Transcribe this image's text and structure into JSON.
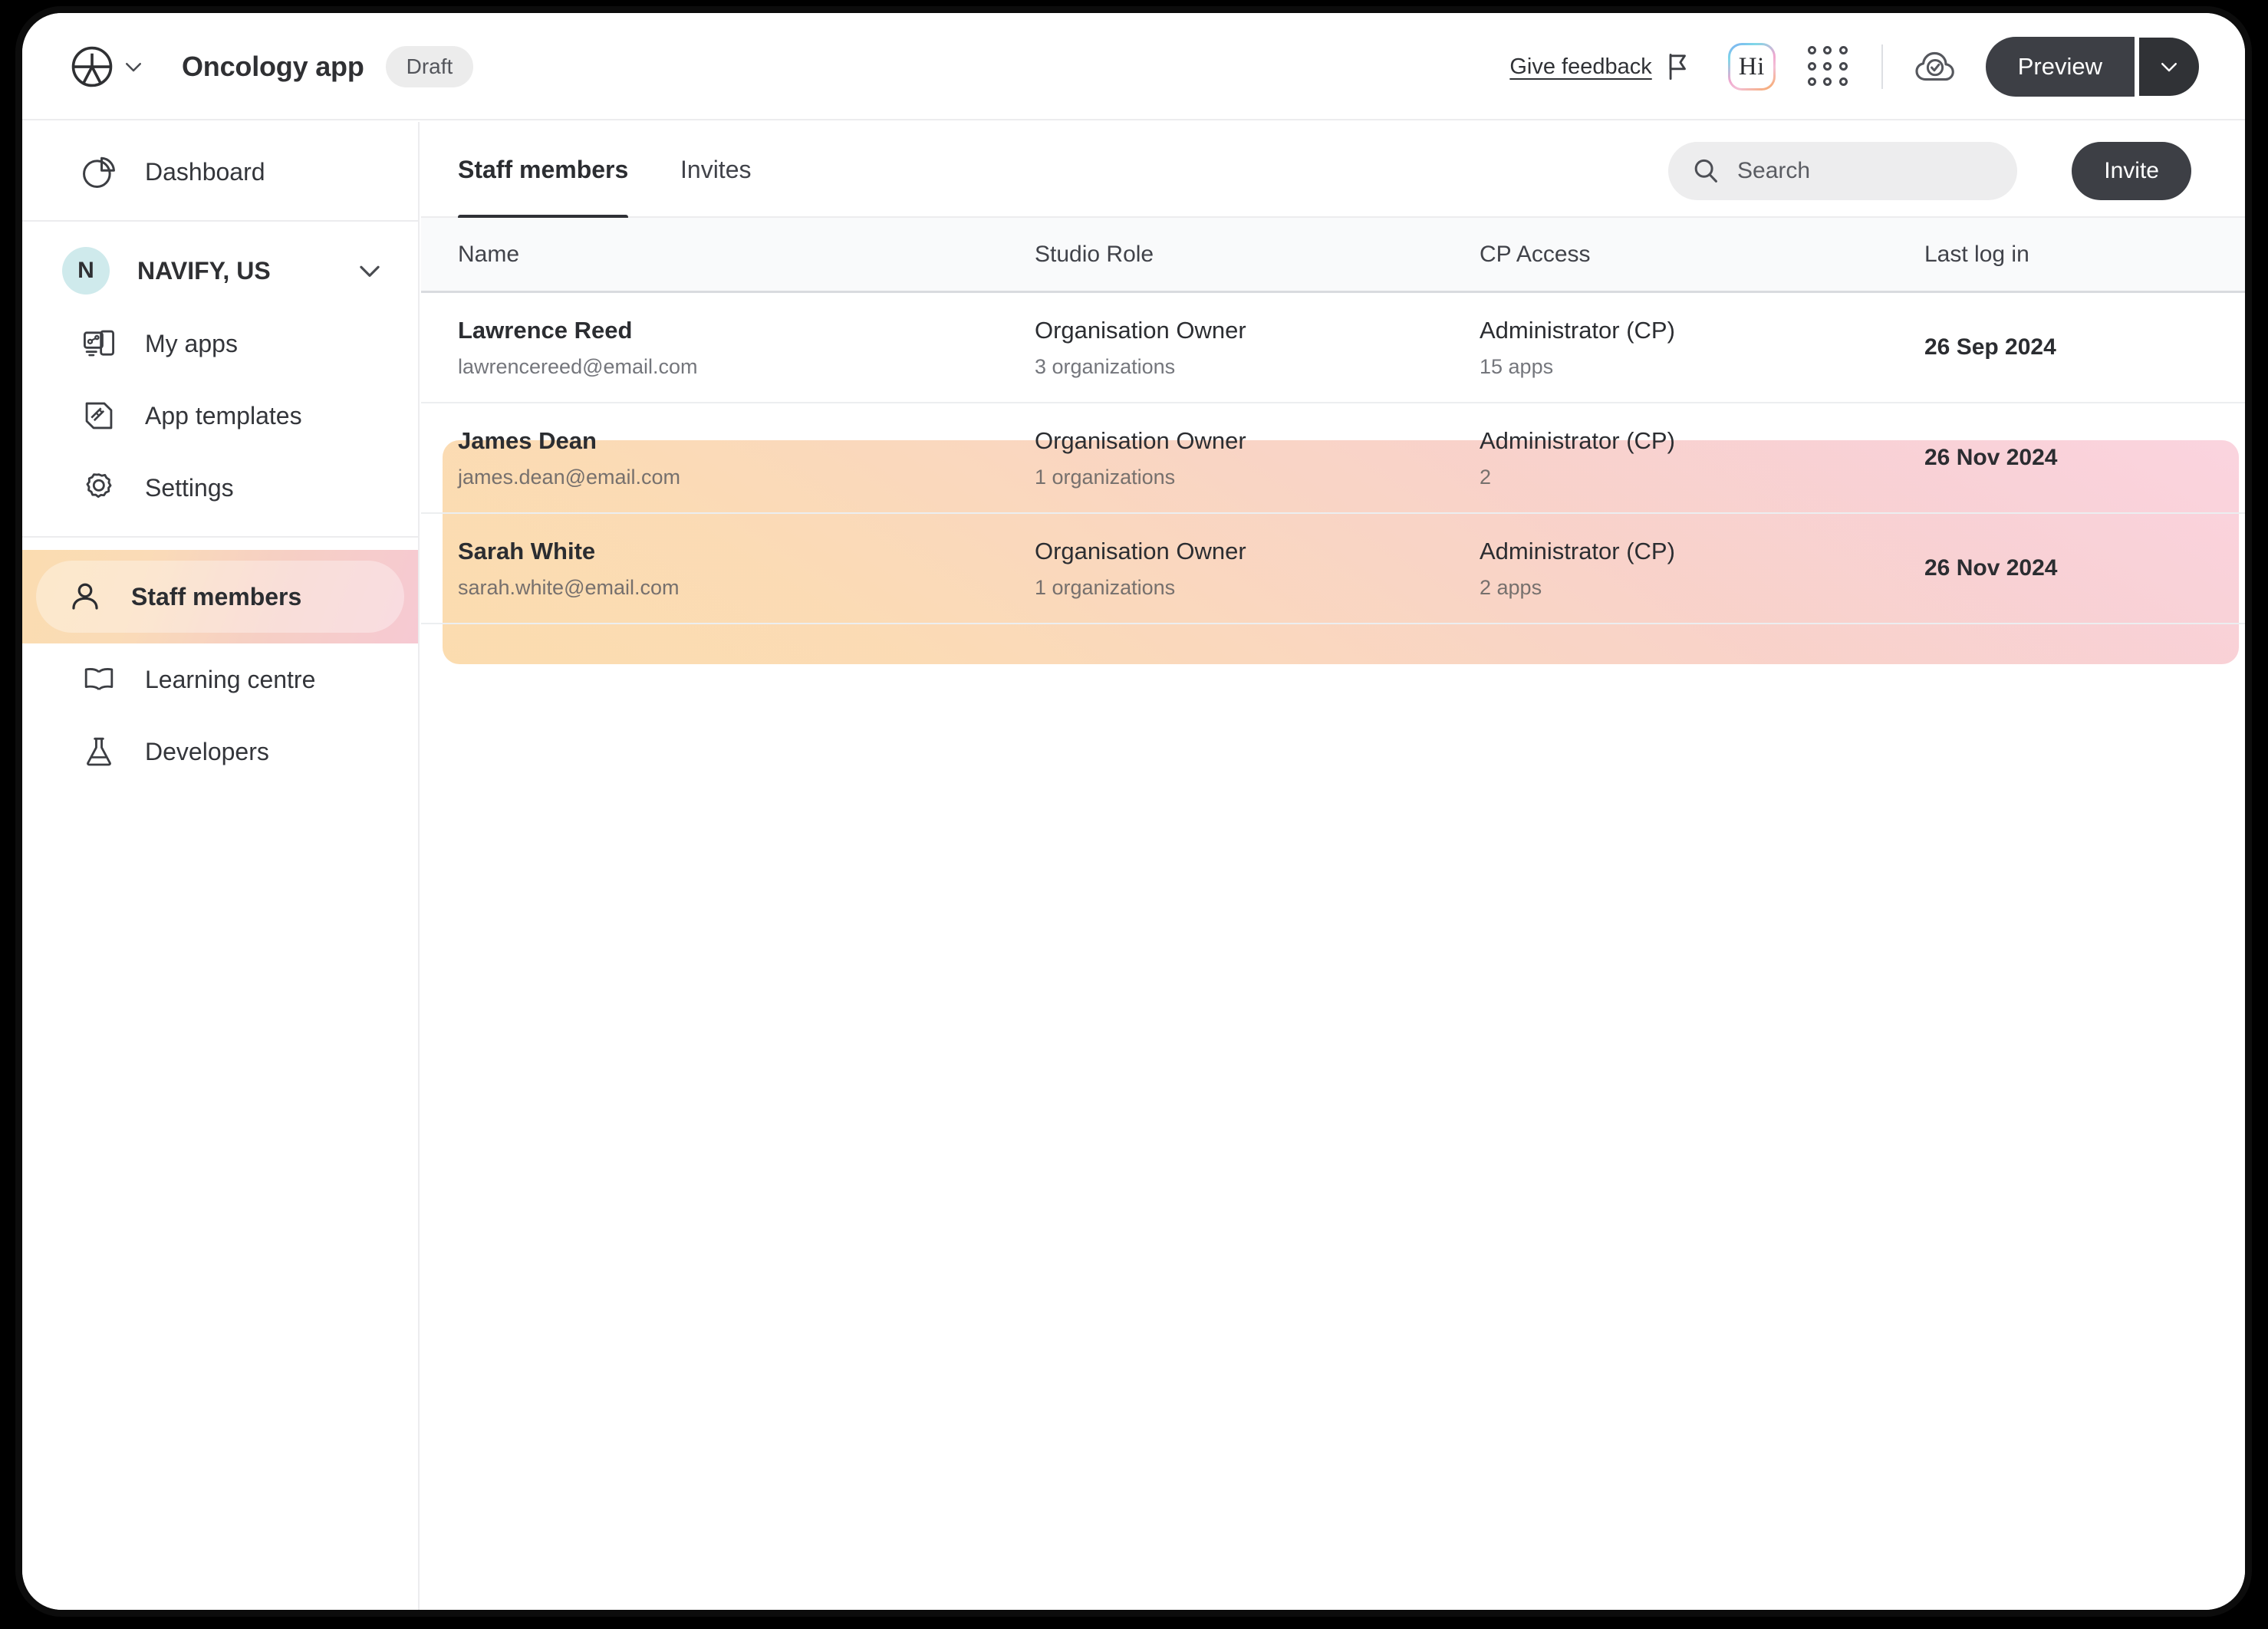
{
  "topbar": {
    "logo_icon": "roche-logo-icon",
    "logo_caret_icon": "chevron-down-icon",
    "app_title": "Oncology app",
    "status_pill": "Draft",
    "feedback_label": "Give feedback",
    "flag_icon": "flag-icon",
    "assistant_badge": "Hi",
    "grid_icon": "app-grid-icon",
    "cloud_icon": "cloud-check-icon",
    "preview_label": "Preview",
    "preview_caret_icon": "chevron-down-icon"
  },
  "sidebar": {
    "dashboard": {
      "label": "Dashboard",
      "icon": "pie-chart-icon"
    },
    "org": {
      "initial": "N",
      "name": "NAVIFY, US",
      "caret_icon": "chevron-down-icon"
    },
    "items": [
      {
        "label": "My apps",
        "icon": "apps-devices-icon",
        "selected": false
      },
      {
        "label": "App templates",
        "icon": "ruler-template-icon",
        "selected": false
      },
      {
        "label": "Settings",
        "icon": "gear-icon",
        "selected": false
      }
    ],
    "items2": [
      {
        "label": "Staff members",
        "icon": "user-icon",
        "selected": true
      },
      {
        "label": "Learning centre",
        "icon": "book-icon",
        "selected": false
      },
      {
        "label": "Developers",
        "icon": "flask-icon",
        "selected": false
      }
    ]
  },
  "main": {
    "tabs": [
      {
        "label": "Staff members",
        "active": true
      },
      {
        "label": "Invites",
        "active": false
      }
    ],
    "search": {
      "placeholder": "Search",
      "value": "",
      "icon": "search-icon"
    },
    "invite_button": "Invite",
    "table": {
      "columns": [
        "Name",
        "Studio Role",
        "CP Access",
        "Last log in"
      ],
      "row_menu_icon": "more-horizontal-icon",
      "rows": [
        {
          "name": "Lawrence Reed",
          "email": "lawrencereed@email.com",
          "role": "Organisation Owner",
          "role_sub": "3 organizations",
          "cp_access": "Administrator (CP)",
          "cp_sub": "15 apps",
          "last_login": "26 Sep 2024",
          "selected": false
        },
        {
          "name": "James Dean",
          "email": "james.dean@email.com",
          "role": "Organisation Owner",
          "role_sub": "1 organizations",
          "cp_access": "Administrator (CP)",
          "cp_sub": "2",
          "last_login": "26 Nov 2024",
          "selected": true
        },
        {
          "name": "Sarah White",
          "email": "sarah.white@email.com",
          "role": "Organisation Owner",
          "role_sub": "1 organizations",
          "cp_access": "Administrator (CP)",
          "cp_sub": "2 apps",
          "last_login": "26 Nov 2024",
          "selected": true
        }
      ]
    }
  },
  "colors": {
    "dark_button": "#3d3f45",
    "highlight_peach": "#fbd9a8",
    "highlight_pink": "#fad0dc",
    "org_avatar": "#cfeaec",
    "header_row_bg": "#f9fafb"
  }
}
